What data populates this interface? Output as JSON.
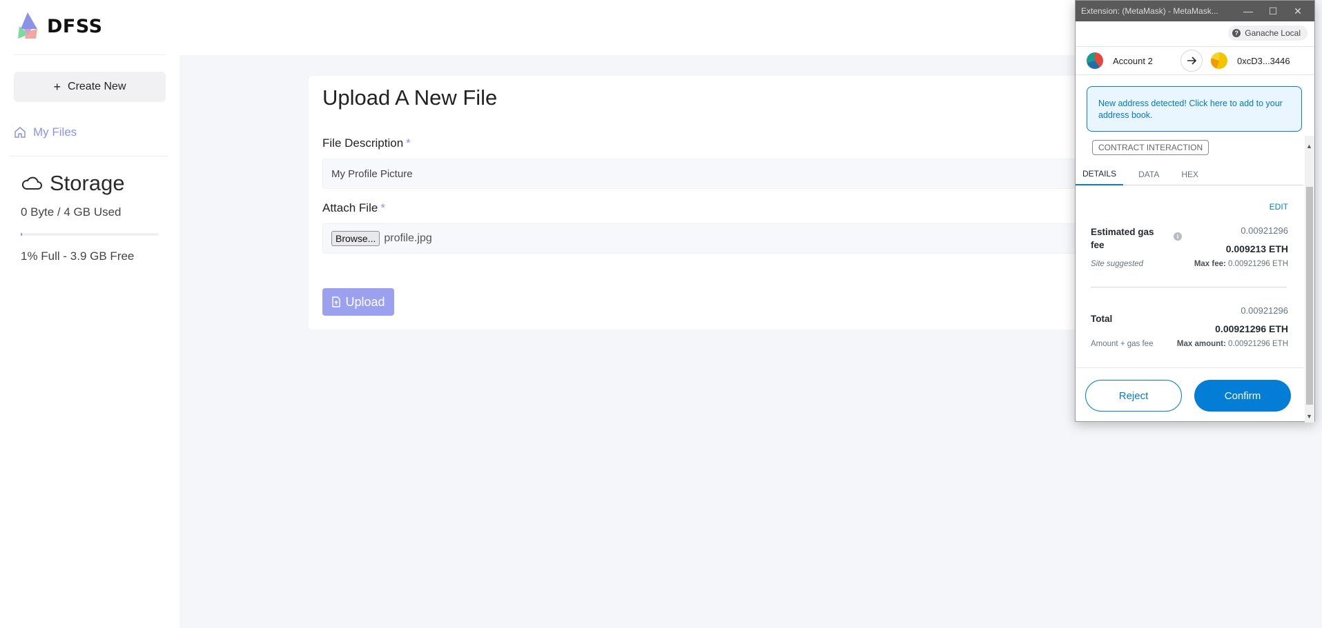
{
  "brand": {
    "name": "DFSS"
  },
  "sidebar": {
    "create_label": "Create New",
    "nav_items": [
      {
        "label": "My Files",
        "icon": "home-icon"
      }
    ],
    "storage": {
      "title": "Storage",
      "used": "0 Byte / 4 GB Used",
      "free": "1% Full - 3.9 GB Free",
      "fill_percent": 1
    }
  },
  "upload": {
    "title": "Upload A New File",
    "description_label": "File Description",
    "description_value": "My Profile Picture",
    "attach_label": "Attach File",
    "required_mark": "*",
    "browse_label": "Browse...",
    "file_name": "profile.jpg",
    "upload_label": "Upload"
  },
  "metamask": {
    "window_title": "Extension: (MetaMask) - MetaMask...",
    "window_buttons": [
      "—",
      "☐",
      "✕"
    ],
    "network": "Ganache Local",
    "from_account": "Account 2",
    "to_address": "0xcD3...3446",
    "notice": "New address detected! Click here to add to your address book.",
    "chip": "CONTRACT INTERACTION",
    "tabs": [
      "DETAILS",
      "DATA",
      "HEX"
    ],
    "active_tab": "DETAILS",
    "edit_label": "EDIT",
    "gas": {
      "label": "Estimated gas fee",
      "value_gray": "0.00921296",
      "value_bold": "0.009213 ETH",
      "note": "Site suggested",
      "max_label": "Max fee:",
      "max_value": "0.00921296 ETH"
    },
    "total": {
      "label": "Total",
      "value_gray": "0.00921296",
      "value_bold": "0.00921296 ETH",
      "note": "Amount + gas fee",
      "max_label": "Max amount:",
      "max_value": "0.00921296 ETH"
    },
    "reject_label": "Reject",
    "confirm_label": "Confirm",
    "colors": {
      "primary": "#037dd6",
      "notice_bg": "#eaf6ff"
    }
  },
  "colors": {
    "accent": "#8b93e6",
    "upload_button": "#9ba1ef"
  }
}
